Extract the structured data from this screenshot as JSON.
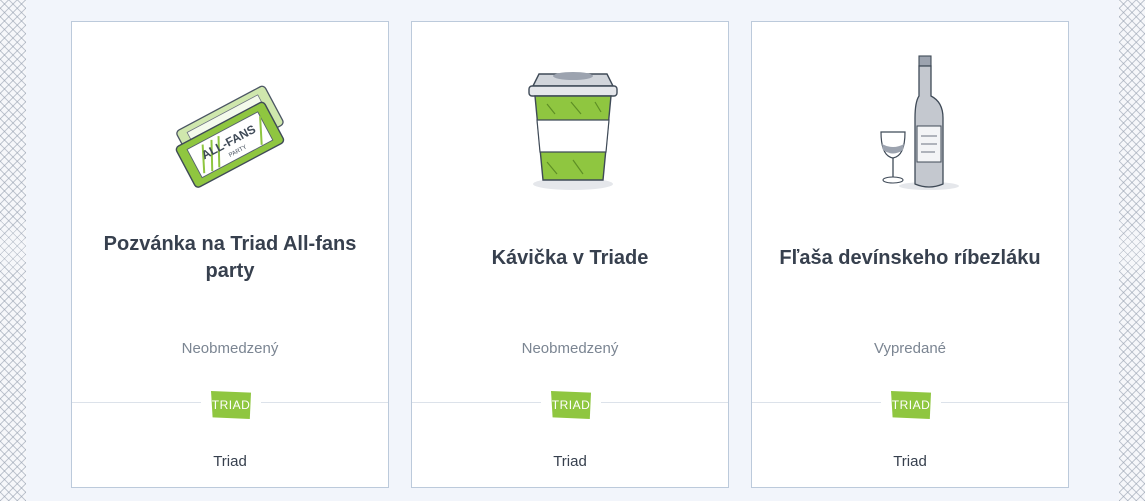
{
  "cards": [
    {
      "illustration": "tickets-icon",
      "title": "Pozvánka na Triad All-fans party",
      "availability": "Neobmedzený",
      "logo_text": "TRIAD",
      "merchant": "Triad",
      "ticket_text_1": "ALL-FANS",
      "ticket_text_2": "PARTY"
    },
    {
      "illustration": "coffee-cup-icon",
      "title": "Kávička v Triade",
      "availability": "Neobmedzený",
      "logo_text": "TRIAD",
      "merchant": "Triad"
    },
    {
      "illustration": "wine-bottle-icon",
      "title": "Fľaša devínskeho ríbezláku",
      "availability": "Vypredané",
      "logo_text": "TRIAD",
      "merchant": "Triad"
    }
  ],
  "colors": {
    "accent_green": "#8fc640",
    "title_text": "#37404e",
    "muted_text": "#7b8592",
    "card_border": "#bccadb",
    "page_background": "#f2f5fb"
  }
}
